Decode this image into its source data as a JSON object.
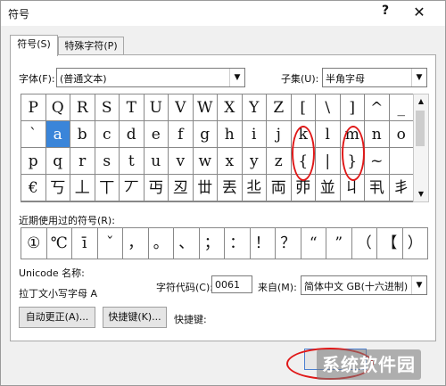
{
  "window": {
    "title": "符号",
    "help": "?",
    "close": "✕"
  },
  "tabs": [
    {
      "label": "符号(S)"
    },
    {
      "label": "特殊字符(P)"
    }
  ],
  "font": {
    "label": "字体(F):",
    "value": "(普通文本)"
  },
  "subset": {
    "label": "子集(U):",
    "value": "半角字母"
  },
  "grid": {
    "rows": [
      [
        "P",
        "Q",
        "R",
        "S",
        "T",
        "U",
        "V",
        "W",
        "X",
        "Y",
        "Z",
        "[",
        "\\",
        "]",
        "^",
        "_"
      ],
      [
        "`",
        "a",
        "b",
        "c",
        "d",
        "e",
        "f",
        "g",
        "h",
        "i",
        "j",
        "k",
        "l",
        "m",
        "n",
        "o"
      ],
      [
        "p",
        "q",
        "r",
        "s",
        "t",
        "u",
        "v",
        "w",
        "x",
        "y",
        "z",
        "{",
        "|",
        "}",
        "~",
        ""
      ],
      [
        "€",
        "丂",
        "丄",
        "丅",
        "丆",
        "丏",
        "丒",
        "丗",
        "丟",
        "丠",
        "両",
        "丣",
        "並",
        "丩",
        "丮",
        "丯"
      ]
    ],
    "selected": "a"
  },
  "recent": {
    "label": "近期使用过的符号(R):",
    "symbols": [
      "①",
      "℃",
      "ī",
      "ˇ",
      "，",
      "。",
      "、",
      "；",
      "：",
      "！",
      "？",
      "“",
      "”",
      "（",
      "【",
      "）"
    ]
  },
  "unicode": {
    "label": "Unicode 名称:",
    "name": "拉丁文小写字母 A"
  },
  "char_code": {
    "label": "字符代码(C):",
    "value": "0061"
  },
  "from": {
    "label": "来自(M):",
    "value": "简体中文 GB(十六进制)"
  },
  "buttons": {
    "autocorrect": "自动更正(A)...",
    "shortcut_key": "快捷键(K)...",
    "shortcut_label": "快捷键:"
  },
  "watermark": "系统软件园",
  "colors": {
    "selection": "#3a85d9",
    "annotation": "#e01818"
  }
}
